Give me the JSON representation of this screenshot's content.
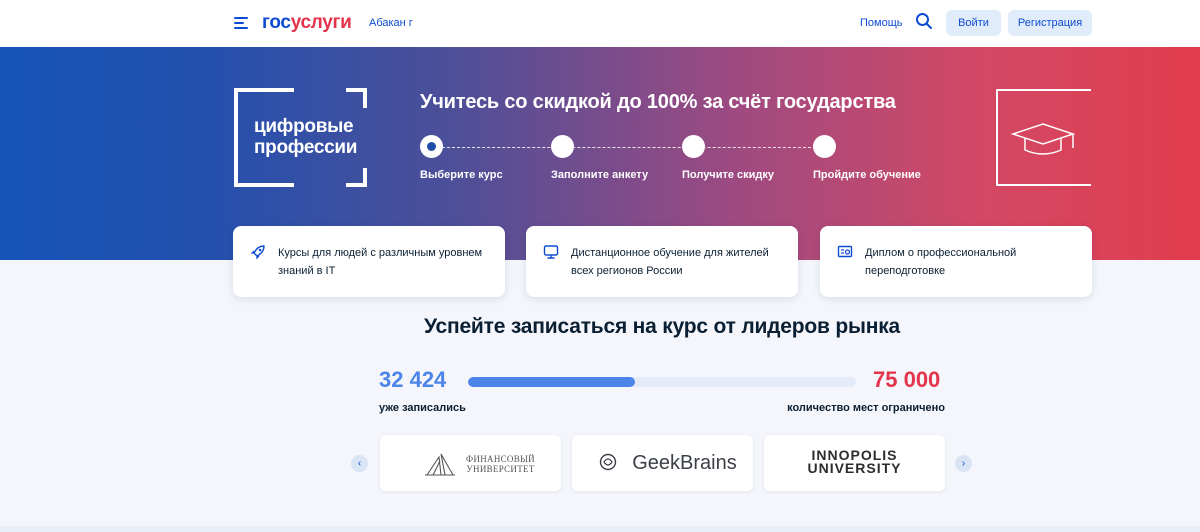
{
  "header": {
    "logo_part1": "гос",
    "logo_part2": "услуги",
    "city": "Абакан г",
    "help": "Помощь",
    "login": "Войти",
    "register": "Регистрация"
  },
  "hero": {
    "logo_line1": "цифровые",
    "logo_line2": "профессии",
    "title": "Учитесь со скидкой до 100% за счёт государства",
    "steps": [
      {
        "label": "Выберите курс",
        "active": true
      },
      {
        "label": "Заполните анкету",
        "active": false
      },
      {
        "label": "Получите скидку",
        "active": false
      },
      {
        "label": "Пройдите обучение",
        "active": false
      }
    ],
    "decor_icon": "graduation-cap-icon"
  },
  "features": [
    {
      "icon": "rocket-icon",
      "text": "Курсы для людей с различным уровнем знаний в IT"
    },
    {
      "icon": "monitor-icon",
      "text": "Дистанционное обучение для жителей всех регионов России"
    },
    {
      "icon": "diploma-icon",
      "text": "Диплом о профессиональной переподготовке"
    }
  ],
  "courses": {
    "title": "Успейте записаться на курс от лидеров рынка",
    "enrolled_value": "32 424",
    "enrolled_label": "уже записались",
    "total_value": "75 000",
    "total_label": "количество мест ограничено",
    "progress_fraction": 0.43,
    "colors": {
      "enrolled": "#4d84e8",
      "total": "#e4344c"
    }
  },
  "partners": [
    {
      "name_line1": "ФИНАНСОВЫЙ",
      "name_line2": "УНИВЕРСИТЕТ"
    },
    {
      "name": "GeekBrains"
    },
    {
      "name_line1": "INNOPOLIS",
      "name_line2": "UNIVERSITY"
    }
  ],
  "carousel": {
    "prev_icon": "chevron-left-icon",
    "next_icon": "chevron-right-icon"
  }
}
